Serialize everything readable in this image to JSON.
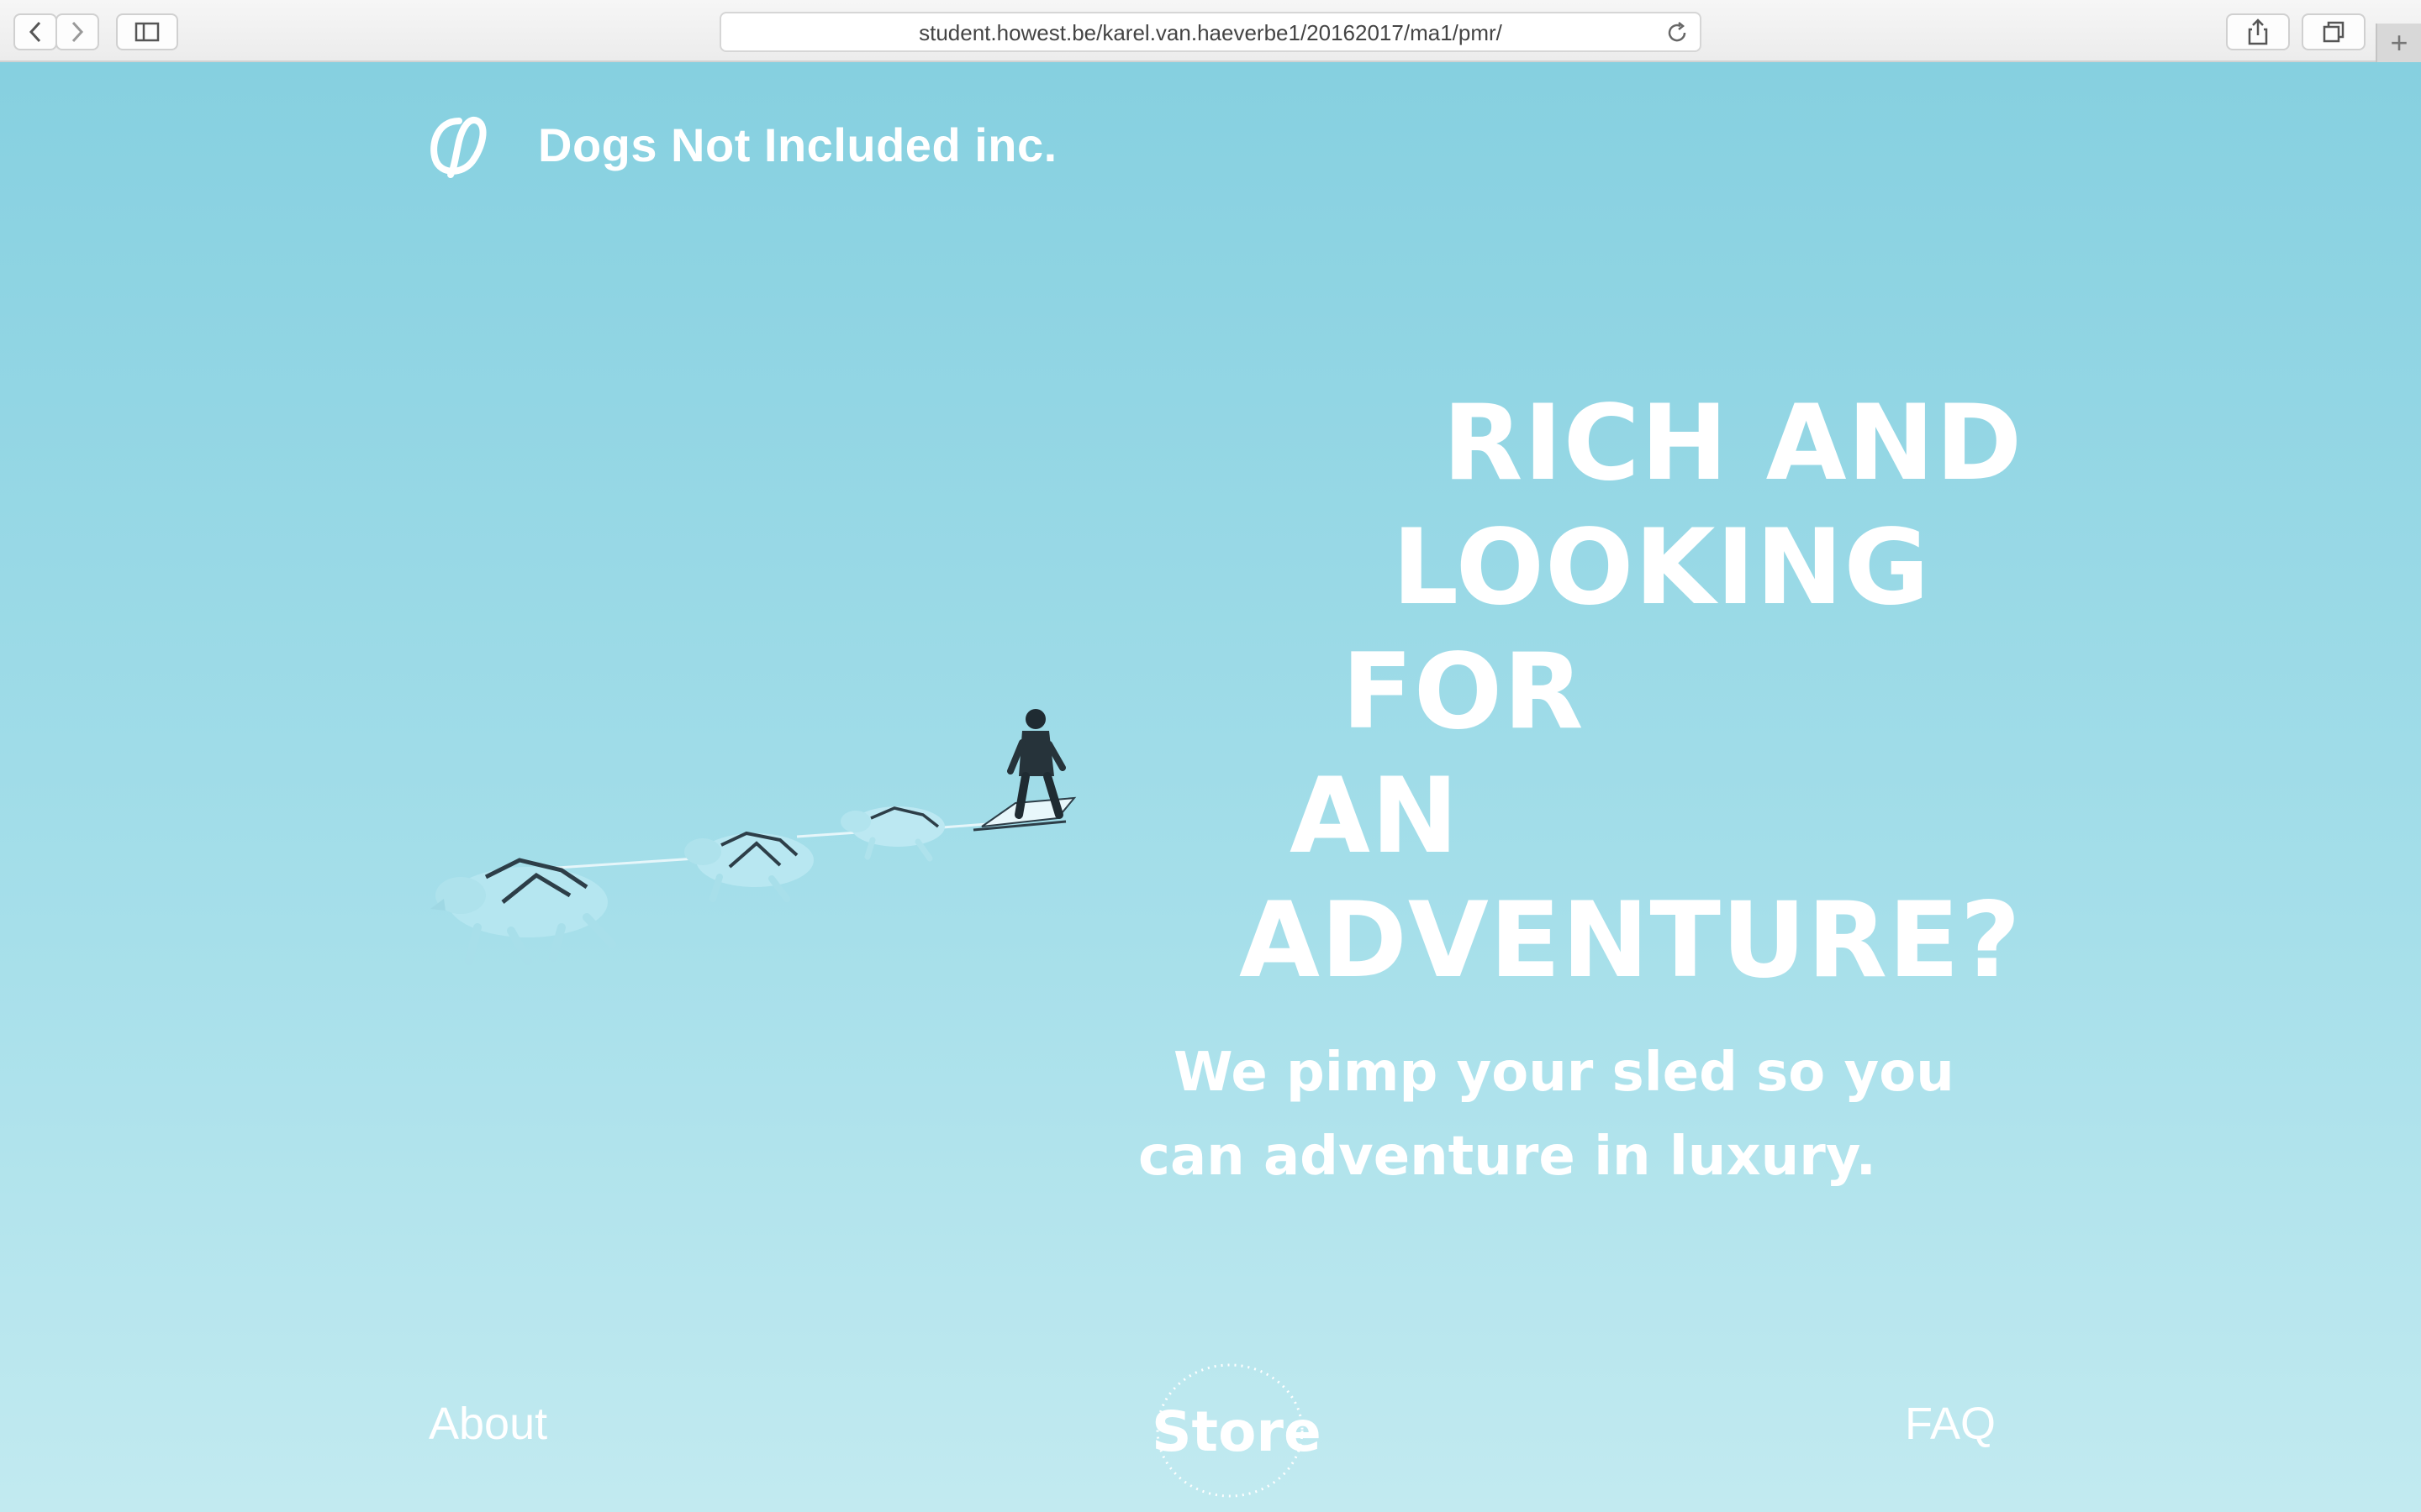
{
  "browser": {
    "url": "student.howest.be/karel.van.haeverbe1/20162017/ma1/pmr/",
    "new_tab_label": "+"
  },
  "site": {
    "brand_name": "Dogs Not Included inc.",
    "headline": [
      "RICH AND",
      "LOOKING",
      "FOR",
      "AN",
      "ADVENTURE?"
    ],
    "subline": [
      "We pimp your sled so you",
      "can adventure in luxury."
    ],
    "nav": {
      "about": "About",
      "store": "Store",
      "faq": "FAQ"
    }
  },
  "colors": {
    "background_top": "#86d0e0",
    "background_bottom": "#c2eaf0",
    "text": "#ffffff"
  }
}
